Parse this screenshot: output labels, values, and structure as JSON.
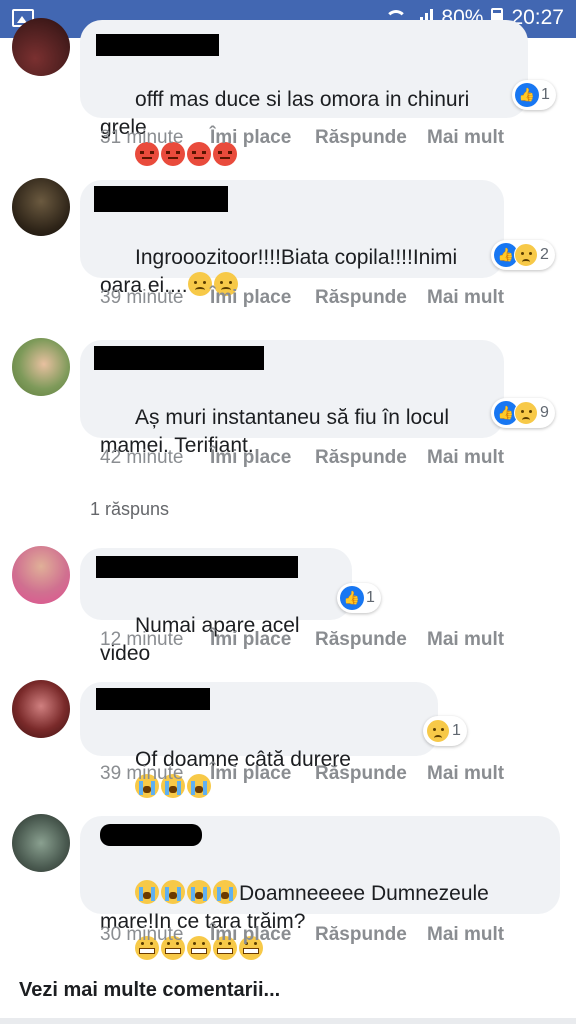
{
  "status_bar": {
    "battery": "80%",
    "time": "20:27"
  },
  "comments": [
    {
      "text": "offf mas duce si las omora in chinuri grele",
      "time": "31 minute",
      "reaction_count": "1",
      "reactions": [
        "like-icon"
      ]
    },
    {
      "text": "Ingrooozitoor!!!!Biata copila!!!!Inimi oara ei....",
      "time": "39 minute",
      "reaction_count": "2",
      "reactions": [
        "like-icon",
        "sad-icon"
      ]
    },
    {
      "text": "Aș muri instantaneu să fiu în locul mamei. Terifiant.",
      "time": "42 minute",
      "reaction_count": "9",
      "reactions": [
        "like-icon",
        "sad-icon"
      ]
    },
    {
      "text": "Numai apare acel video",
      "time": "12 minute",
      "reaction_count": "1",
      "reactions": [
        "like-icon"
      ]
    },
    {
      "text": "Of doamne câtă durere",
      "time": "39 minute",
      "reaction_count": "1",
      "reactions": [
        "sad-icon"
      ]
    },
    {
      "text": "Doamneeeee Dumnezeule mare!In ce tara trăim?",
      "time": "30 minute",
      "reaction_count": "",
      "reactions": []
    }
  ],
  "actions": {
    "like": "Îmi place",
    "reply": "Răspunde",
    "more": "Mai mult"
  },
  "replies_link": "1 răspuns",
  "see_more": "Vezi mai multe comentarii...",
  "colors": {
    "status_bar": "#4267b2",
    "bubble": "#f0f2f5",
    "like": "#1877f2"
  }
}
